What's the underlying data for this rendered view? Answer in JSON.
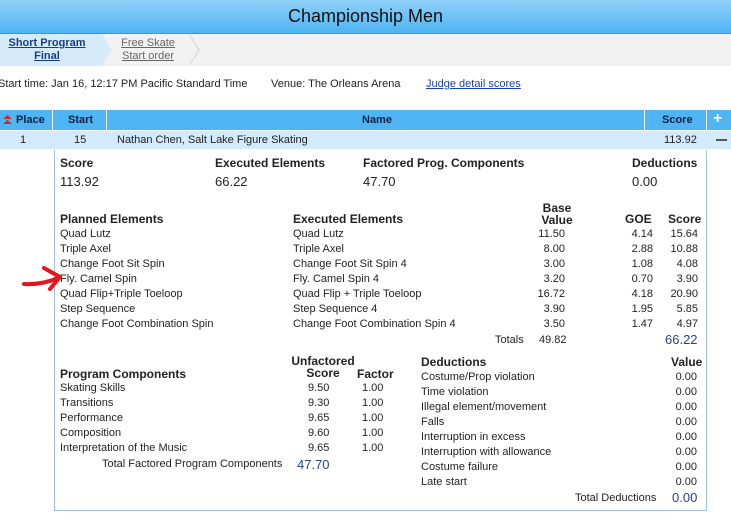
{
  "title": "Championship Men",
  "tabs": [
    {
      "line1": "Short Program",
      "line2": "Final"
    },
    {
      "line1": "Free Skate",
      "line2": "Start order"
    }
  ],
  "info": {
    "start_time": "Start time: Jan 16, 12:17 PM Pacific Standard Time",
    "venue": "Venue: The Orleans Arena",
    "judge_link": "Judge detail scores"
  },
  "table_header": {
    "place": "Place",
    "start": "Start",
    "name": "Name",
    "score": "Score"
  },
  "row": {
    "place": "1",
    "start": "15",
    "name": "Nathan Chen, Salt Lake Figure Skating",
    "score": "113.92"
  },
  "summary": {
    "score_label": "Score",
    "score": "113.92",
    "tes_label": "Executed Elements",
    "tes": "66.22",
    "pcs_label": "Factored Prog. Components",
    "pcs": "47.70",
    "ded_label": "Deductions",
    "ded": "0.00"
  },
  "elements": {
    "headers": {
      "planned": "Planned Elements",
      "executed": "Executed Elements",
      "base_line1": "Base",
      "base_line2": "Value",
      "goe": "GOE",
      "score": "Score"
    },
    "rows": [
      {
        "planned": "Quad Lutz",
        "executed": "Quad Lutz",
        "base": "11.50",
        "goe": "4.14",
        "score": "15.64"
      },
      {
        "planned": "Triple Axel",
        "executed": "Triple Axel",
        "base": "8.00",
        "goe": "2.88",
        "score": "10.88"
      },
      {
        "planned": "Change Foot Sit Spin",
        "executed": "Change Foot Sit Spin 4",
        "base": "3.00",
        "goe": "1.08",
        "score": "4.08"
      },
      {
        "planned": "Fly. Camel Spin",
        "executed": "Fly. Camel Spin 4",
        "base": "3.20",
        "goe": "0.70",
        "score": "3.90"
      },
      {
        "planned": "Quad Flip+Triple Toeloop",
        "executed": "Quad Flip + Triple Toeloop",
        "base": "16.72",
        "goe": "4.18",
        "score": "20.90"
      },
      {
        "planned": "Step Sequence",
        "executed": "Step Sequence 4",
        "base": "3.90",
        "goe": "1.95",
        "score": "5.85"
      },
      {
        "planned": "Change Foot Combination Spin",
        "executed": "Change Foot Combination Spin 4",
        "base": "3.50",
        "goe": "1.47",
        "score": "4.97"
      }
    ],
    "totals_label": "Totals",
    "base_total": "49.82",
    "score_total": "66.22"
  },
  "components": {
    "header": "Program Components",
    "unfactored_line1": "Unfactored",
    "unfactored_line2": "Score",
    "factor": "Factor",
    "rows": [
      {
        "name": "Skating Skills",
        "score": "9.50",
        "factor": "1.00"
      },
      {
        "name": "Transitions",
        "score": "9.30",
        "factor": "1.00"
      },
      {
        "name": "Performance",
        "score": "9.65",
        "factor": "1.00"
      },
      {
        "name": "Composition",
        "score": "9.60",
        "factor": "1.00"
      },
      {
        "name": "Interpretation of the Music",
        "score": "9.65",
        "factor": "1.00"
      }
    ],
    "total_label": "Total Factored Program Components",
    "total": "47.70"
  },
  "deductions": {
    "header": "Deductions",
    "value_header": "Value",
    "rows": [
      {
        "name": "Costume/Prop violation",
        "value": "0.00"
      },
      {
        "name": "Time violation",
        "value": "0.00"
      },
      {
        "name": "Illegal element/movement",
        "value": "0.00"
      },
      {
        "name": "Falls",
        "value": "0.00"
      },
      {
        "name": "Interruption in excess",
        "value": "0.00"
      },
      {
        "name": "Interruption with allowance",
        "value": "0.00"
      },
      {
        "name": "Costume failure",
        "value": "0.00"
      },
      {
        "name": "Late start",
        "value": "0.00"
      }
    ],
    "total_label": "Total Deductions",
    "total": "0.00"
  },
  "colors": {
    "header_blue": "#4fb4f2",
    "row_blue": "#d2eafb",
    "arrow_red": "#e8141b",
    "link_blue": "#1a3db8"
  }
}
